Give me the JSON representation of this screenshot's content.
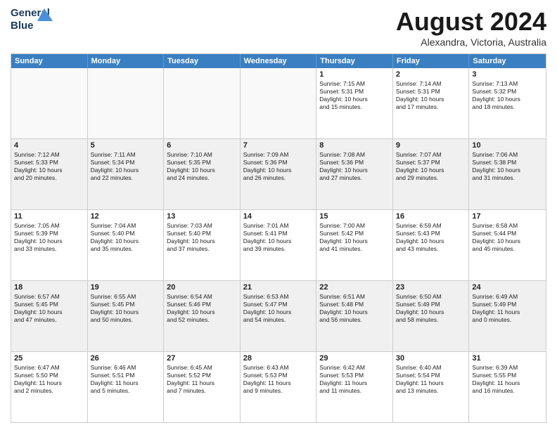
{
  "header": {
    "logo_line1": "General",
    "logo_line2": "Blue",
    "month": "August 2024",
    "location": "Alexandra, Victoria, Australia"
  },
  "weekdays": [
    "Sunday",
    "Monday",
    "Tuesday",
    "Wednesday",
    "Thursday",
    "Friday",
    "Saturday"
  ],
  "rows": [
    [
      {
        "day": "",
        "empty": true
      },
      {
        "day": "",
        "empty": true
      },
      {
        "day": "",
        "empty": true
      },
      {
        "day": "",
        "empty": true
      },
      {
        "day": "1",
        "line1": "Sunrise: 7:15 AM",
        "line2": "Sunset: 5:31 PM",
        "line3": "Daylight: 10 hours",
        "line4": "and 15 minutes."
      },
      {
        "day": "2",
        "line1": "Sunrise: 7:14 AM",
        "line2": "Sunset: 5:31 PM",
        "line3": "Daylight: 10 hours",
        "line4": "and 17 minutes."
      },
      {
        "day": "3",
        "line1": "Sunrise: 7:13 AM",
        "line2": "Sunset: 5:32 PM",
        "line3": "Daylight: 10 hours",
        "line4": "and 18 minutes."
      }
    ],
    [
      {
        "day": "4",
        "shaded": true,
        "line1": "Sunrise: 7:12 AM",
        "line2": "Sunset: 5:33 PM",
        "line3": "Daylight: 10 hours",
        "line4": "and 20 minutes."
      },
      {
        "day": "5",
        "shaded": true,
        "line1": "Sunrise: 7:11 AM",
        "line2": "Sunset: 5:34 PM",
        "line3": "Daylight: 10 hours",
        "line4": "and 22 minutes."
      },
      {
        "day": "6",
        "shaded": true,
        "line1": "Sunrise: 7:10 AM",
        "line2": "Sunset: 5:35 PM",
        "line3": "Daylight: 10 hours",
        "line4": "and 24 minutes."
      },
      {
        "day": "7",
        "shaded": true,
        "line1": "Sunrise: 7:09 AM",
        "line2": "Sunset: 5:36 PM",
        "line3": "Daylight: 10 hours",
        "line4": "and 26 minutes."
      },
      {
        "day": "8",
        "shaded": true,
        "line1": "Sunrise: 7:08 AM",
        "line2": "Sunset: 5:36 PM",
        "line3": "Daylight: 10 hours",
        "line4": "and 27 minutes."
      },
      {
        "day": "9",
        "shaded": true,
        "line1": "Sunrise: 7:07 AM",
        "line2": "Sunset: 5:37 PM",
        "line3": "Daylight: 10 hours",
        "line4": "and 29 minutes."
      },
      {
        "day": "10",
        "shaded": true,
        "line1": "Sunrise: 7:06 AM",
        "line2": "Sunset: 5:38 PM",
        "line3": "Daylight: 10 hours",
        "line4": "and 31 minutes."
      }
    ],
    [
      {
        "day": "11",
        "line1": "Sunrise: 7:05 AM",
        "line2": "Sunset: 5:39 PM",
        "line3": "Daylight: 10 hours",
        "line4": "and 33 minutes."
      },
      {
        "day": "12",
        "line1": "Sunrise: 7:04 AM",
        "line2": "Sunset: 5:40 PM",
        "line3": "Daylight: 10 hours",
        "line4": "and 35 minutes."
      },
      {
        "day": "13",
        "line1": "Sunrise: 7:03 AM",
        "line2": "Sunset: 5:40 PM",
        "line3": "Daylight: 10 hours",
        "line4": "and 37 minutes."
      },
      {
        "day": "14",
        "line1": "Sunrise: 7:01 AM",
        "line2": "Sunset: 5:41 PM",
        "line3": "Daylight: 10 hours",
        "line4": "and 39 minutes."
      },
      {
        "day": "15",
        "line1": "Sunrise: 7:00 AM",
        "line2": "Sunset: 5:42 PM",
        "line3": "Daylight: 10 hours",
        "line4": "and 41 minutes."
      },
      {
        "day": "16",
        "line1": "Sunrise: 6:59 AM",
        "line2": "Sunset: 5:43 PM",
        "line3": "Daylight: 10 hours",
        "line4": "and 43 minutes."
      },
      {
        "day": "17",
        "line1": "Sunrise: 6:58 AM",
        "line2": "Sunset: 5:44 PM",
        "line3": "Daylight: 10 hours",
        "line4": "and 45 minutes."
      }
    ],
    [
      {
        "day": "18",
        "shaded": true,
        "line1": "Sunrise: 6:57 AM",
        "line2": "Sunset: 5:45 PM",
        "line3": "Daylight: 10 hours",
        "line4": "and 47 minutes."
      },
      {
        "day": "19",
        "shaded": true,
        "line1": "Sunrise: 6:55 AM",
        "line2": "Sunset: 5:45 PM",
        "line3": "Daylight: 10 hours",
        "line4": "and 50 minutes."
      },
      {
        "day": "20",
        "shaded": true,
        "line1": "Sunrise: 6:54 AM",
        "line2": "Sunset: 5:46 PM",
        "line3": "Daylight: 10 hours",
        "line4": "and 52 minutes."
      },
      {
        "day": "21",
        "shaded": true,
        "line1": "Sunrise: 6:53 AM",
        "line2": "Sunset: 5:47 PM",
        "line3": "Daylight: 10 hours",
        "line4": "and 54 minutes."
      },
      {
        "day": "22",
        "shaded": true,
        "line1": "Sunrise: 6:51 AM",
        "line2": "Sunset: 5:48 PM",
        "line3": "Daylight: 10 hours",
        "line4": "and 56 minutes."
      },
      {
        "day": "23",
        "shaded": true,
        "line1": "Sunrise: 6:50 AM",
        "line2": "Sunset: 5:49 PM",
        "line3": "Daylight: 10 hours",
        "line4": "and 58 minutes."
      },
      {
        "day": "24",
        "shaded": true,
        "line1": "Sunrise: 6:49 AM",
        "line2": "Sunset: 5:49 PM",
        "line3": "Daylight: 11 hours",
        "line4": "and 0 minutes."
      }
    ],
    [
      {
        "day": "25",
        "line1": "Sunrise: 6:47 AM",
        "line2": "Sunset: 5:50 PM",
        "line3": "Daylight: 11 hours",
        "line4": "and 2 minutes."
      },
      {
        "day": "26",
        "line1": "Sunrise: 6:46 AM",
        "line2": "Sunset: 5:51 PM",
        "line3": "Daylight: 11 hours",
        "line4": "and 5 minutes."
      },
      {
        "day": "27",
        "line1": "Sunrise: 6:45 AM",
        "line2": "Sunset: 5:52 PM",
        "line3": "Daylight: 11 hours",
        "line4": "and 7 minutes."
      },
      {
        "day": "28",
        "line1": "Sunrise: 6:43 AM",
        "line2": "Sunset: 5:53 PM",
        "line3": "Daylight: 11 hours",
        "line4": "and 9 minutes."
      },
      {
        "day": "29",
        "line1": "Sunrise: 6:42 AM",
        "line2": "Sunset: 5:53 PM",
        "line3": "Daylight: 11 hours",
        "line4": "and 11 minutes."
      },
      {
        "day": "30",
        "line1": "Sunrise: 6:40 AM",
        "line2": "Sunset: 5:54 PM",
        "line3": "Daylight: 11 hours",
        "line4": "and 13 minutes."
      },
      {
        "day": "31",
        "line1": "Sunrise: 6:39 AM",
        "line2": "Sunset: 5:55 PM",
        "line3": "Daylight: 11 hours",
        "line4": "and 16 minutes."
      }
    ]
  ]
}
